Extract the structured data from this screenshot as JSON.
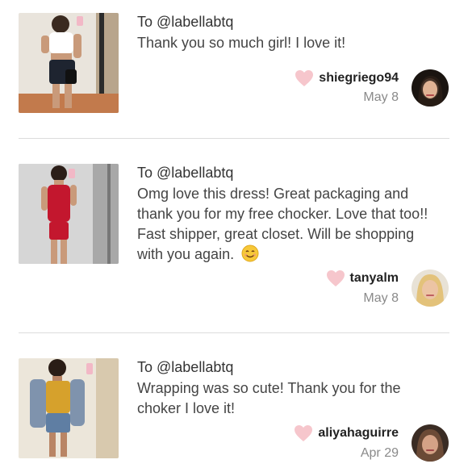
{
  "reviews": [
    {
      "to": "To @labellabtq",
      "message": "Thank you so much girl! I love it!",
      "username": "shiegriego94",
      "date": "May 8"
    },
    {
      "to": "To @labellabtq",
      "message": "Omg love this dress! Great packaging and thank you for my free chocker. Love that too!! Fast shipper, great closet. Will be shopping with you again.",
      "username": "tanyalm",
      "date": "May 8"
    },
    {
      "to": "To @labellabtq",
      "message": "Wrapping was so cute! Thank you for the choker I love it!",
      "username": "aliyahaguirre",
      "date": "Apr 29"
    }
  ],
  "colors": {
    "heart": "#f6c6cc",
    "divider": "#dcdcdc",
    "date": "#8a8a8a"
  },
  "icons": {
    "like": "heart-icon",
    "smile": "smiling-face-emoji"
  }
}
